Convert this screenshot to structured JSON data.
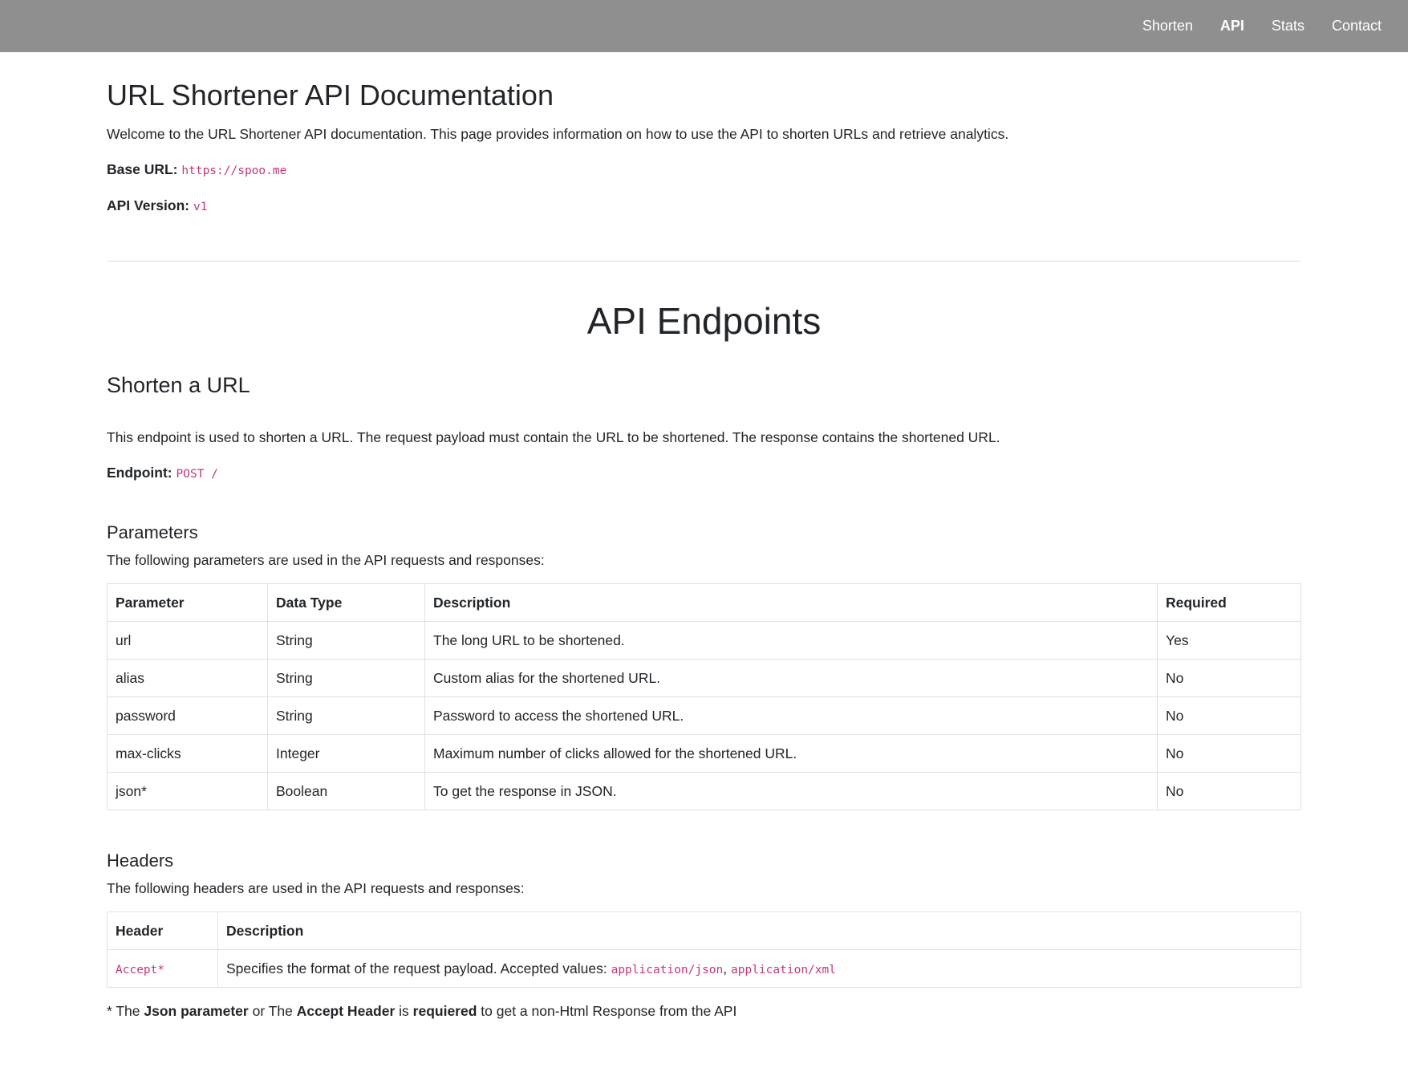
{
  "nav": {
    "items": [
      {
        "label": "Shorten",
        "active": false
      },
      {
        "label": "API",
        "active": true
      },
      {
        "label": "Stats",
        "active": false
      },
      {
        "label": "Contact",
        "active": false
      }
    ]
  },
  "intro": {
    "title": "URL Shortener API Documentation",
    "description": "Welcome to the URL Shortener API documentation. This page provides information on how to use the API to shorten URLs and retrieve analytics.",
    "base_url_label": "Base URL:",
    "base_url_value": "https://spoo.me",
    "api_version_label": "API Version:",
    "api_version_value": "v1"
  },
  "endpoints": {
    "title": "API Endpoints",
    "shorten": {
      "title": "Shorten a URL",
      "description": "This endpoint is used to shorten a URL. The request payload must contain the URL to be shortened. The response contains the shortened URL.",
      "endpoint_label": "Endpoint:",
      "endpoint_value": "POST /"
    }
  },
  "parameters": {
    "title": "Parameters",
    "description": "The following parameters are used in the API requests and responses:",
    "headers": [
      "Parameter",
      "Data Type",
      "Description",
      "Required"
    ],
    "rows": [
      [
        "url",
        "String",
        "The long URL to be shortened.",
        "Yes"
      ],
      [
        "alias",
        "String",
        "Custom alias for the shortened URL.",
        "No"
      ],
      [
        "password",
        "String",
        "Password to access the shortened URL.",
        "No"
      ],
      [
        "max-clicks",
        "Integer",
        "Maximum number of clicks allowed for the shortened URL.",
        "No"
      ],
      [
        "json*",
        "Boolean",
        "To get the response in JSON.",
        "No"
      ]
    ]
  },
  "headers_section": {
    "title": "Headers",
    "description": "The following headers are used in the API requests and responses:",
    "headers": [
      "Header",
      "Description"
    ],
    "row": {
      "name": "Accept*",
      "description": "Specifies the format of the request payload. Accepted values: ",
      "value1": "application/json",
      "separator": ", ",
      "value2": "application/xml"
    }
  },
  "footnote": {
    "prefix": "* The ",
    "bold1": "Json parameter",
    "mid1": " or The ",
    "bold2": "Accept Header",
    "mid2": " is ",
    "bold3": "requiered",
    "suffix": " to get a non-Html Response from the API"
  },
  "colors": {
    "navbar": "#8f8f8f",
    "code": "#c7357a",
    "text": "#212529"
  }
}
